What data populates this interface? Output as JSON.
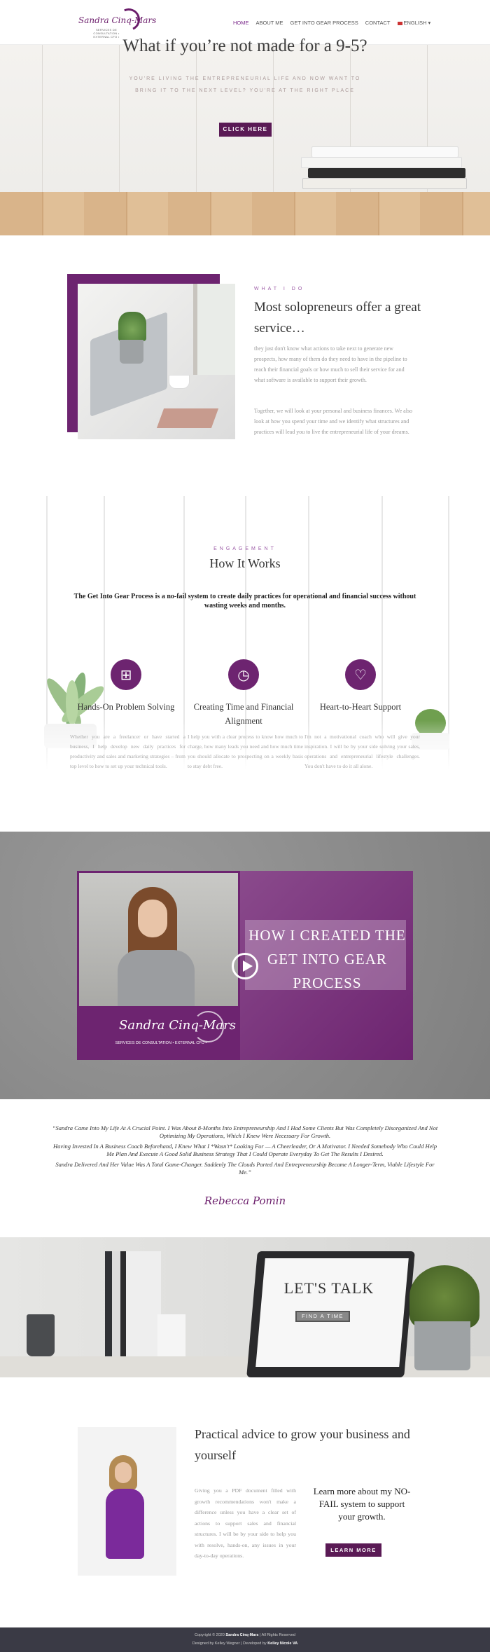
{
  "header": {
    "logo_script": "Sandra Cinq-Mars",
    "logo_sub": "SERVICES DE CONSULTATION • EXTERNAL CFO •",
    "nav": [
      {
        "label": "HOME",
        "active": true
      },
      {
        "label": "ABOUT ME",
        "active": false
      },
      {
        "label": "GET INTO GEAR PROCESS",
        "active": false
      },
      {
        "label": "CONTACT",
        "active": false
      }
    ],
    "language": "ENGLISH",
    "language_caret": "▾"
  },
  "hero": {
    "title": "What if you’re not made for a 9-5?",
    "subtitle": "YOU'RE LIVING THE ENTREPRENEURIAL LIFE AND NOW WANT TO BRING IT TO THE NEXT LEVEL? YOU'RE AT THE RIGHT PLACE",
    "button": "CLICK HERE"
  },
  "what_i_do": {
    "eyebrow": "WHAT I DO",
    "title": "Most solopreneurs offer a great service…",
    "p1": "they just don't know what actions to take next to generate new prospects, how many of them do they need to have in the pipeline to reach their financial goals or how much to sell their service for and what software is available to support their growth.",
    "p2": "Together, we will look at your personal and business finances. We also look at how you spend your time and we identify what structures and practices will lead you to live the entrepreneurial life of your dreams."
  },
  "how_it_works": {
    "eyebrow": "ENGAGEMENT",
    "title": "How It Works",
    "intro": "The Get Into Gear Process is a no-fail system to create daily practices for operational and financial success without wasting weeks and months.",
    "columns": [
      {
        "icon": "sitemap-icon",
        "glyph": "⊞",
        "title": "Hands-On Problem Solving",
        "text": "Whether you are a freelancer or have started a business, I help develop new daily practices for productivity and sales and marketing strategies – from top level to how to set up your technical tools."
      },
      {
        "icon": "clock-icon",
        "glyph": "◷",
        "title": "Creating Time and Financial Alignment",
        "text": "I help you with a clear process to know how much to charge, how many leads you need and how much time you should allocate to prospecting on a weekly basis to stay debt free."
      },
      {
        "icon": "heart-icon",
        "glyph": "♡",
        "title": "Heart-to-Heart Support",
        "text": "I'm not a motivational coach who will give your inspiration. I will be by your side solving your sales, operations and entrepreneurial lifestyle challenges. You don't have to do it all alone."
      }
    ]
  },
  "video": {
    "headline": "HOW I CREATED THE GET INTO GEAR PROCESS",
    "logo_script": "Sandra Cinq-Mars",
    "logo_sub": "SERVICES DE CONSULTATION • EXTERNAL CFO •"
  },
  "testimonial": {
    "quote": [
      "“Sandra Came Into My Life At A Crucial Point. I Was About 8-Months Into Entrepreneurship And I Had Some Clients But Was Completely Disorganized And Not Optimizing My Operations, Which I Knew Were Necessary For Growth.",
      "Having Invested In A Business Coach Beforehand, I Knew What I *Wasn't* Looking For — A Cheerleader, Or A Motivator. I Needed Somebody Who Could Help Me Plan And Execute A Good Solid Business Strategy That I Could Operate Everyday To Get The Results I Desired.",
      "Sandra Delivered And Her Value Was A Total Game-Changer. Suddenly The Clouds Parted And Entrepreneurship Became A Longer-Term, Viable Lifestyle For Me.”"
    ],
    "signature": "Rebecca Pomin"
  },
  "talk": {
    "title": "LET'S TALK",
    "button": "FIND A TIME"
  },
  "practical": {
    "title": "Practical advice to grow your business and yourself",
    "text": "Giving you a PDF document filled with growth recommendations won't make a difference unless you have a clear set of actions to support sales and financial structures. I will be by your side to help you with resolve, hands-on, any issues in your day-to-day operations.",
    "cta": "Learn more about my NO-FAIL system to support your growth.",
    "button": "LEARN MORE"
  },
  "footer": {
    "copyright_prefix": "Copyright © 2020",
    "copyright_name": "Sandra Cinq-Mars",
    "copyright_suffix": "| All Rights Reserved",
    "designed_prefix": "Designed by Kelley Wegner | Developed by",
    "designed_name": "Kelley Nicole VA"
  }
}
